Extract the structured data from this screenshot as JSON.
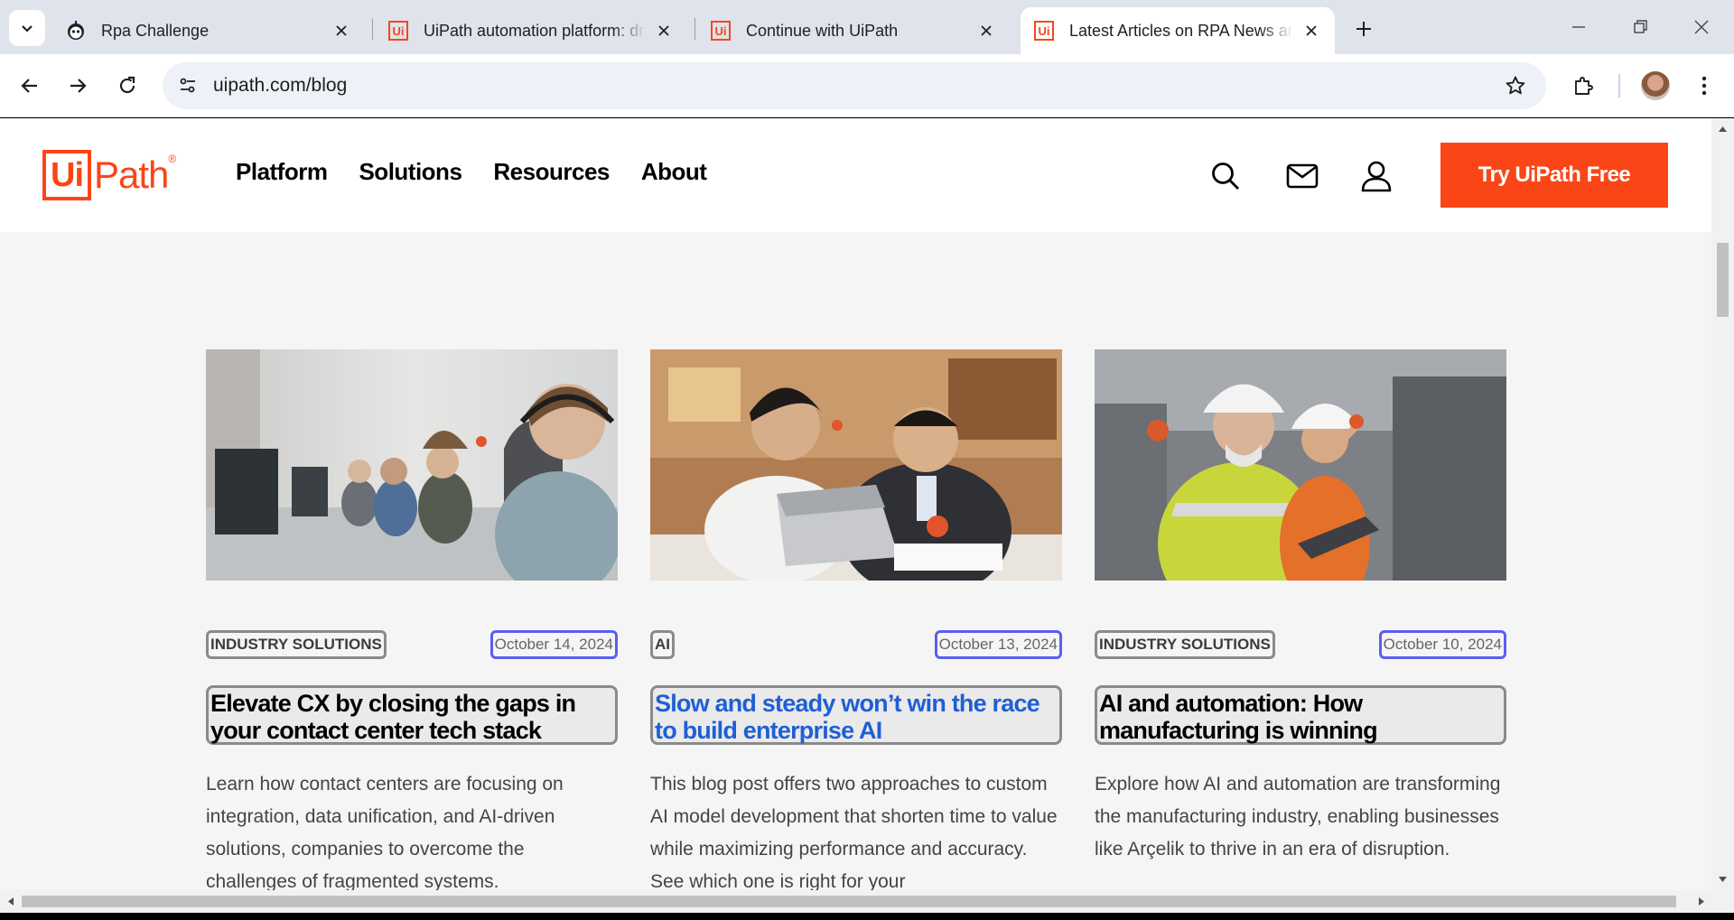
{
  "browser": {
    "tabs": [
      {
        "title": "Rpa Challenge",
        "favicon": "robot-icon",
        "active": false
      },
      {
        "title": "UiPath automation platform: drive",
        "favicon": "uipath-icon",
        "active": false
      },
      {
        "title": "Continue with UiPath",
        "favicon": "uipath-icon",
        "active": false
      },
      {
        "title": "Latest Articles on RPA News and",
        "favicon": "uipath-icon",
        "active": true
      }
    ],
    "favicon_text": "Ui",
    "url": "uipath.com/blog"
  },
  "site": {
    "logo": {
      "ui": "Ui",
      "path": "Path",
      "reg": "®"
    },
    "nav": [
      "Platform",
      "Solutions",
      "Resources",
      "About"
    ],
    "cta": "Try UiPath Free",
    "brand_color": "#fa4616"
  },
  "articles": [
    {
      "tag": "INDUSTRY SOLUTIONS",
      "date": "October 14, 2024",
      "title": "Elevate CX by closing the gaps in your contact center tech stack",
      "excerpt": "Learn how contact centers are focusing on integration, data unification, and AI-driven solutions, companies to overcome the challenges of fragmented systems.",
      "image": "contact-center-agents-photo"
    },
    {
      "tag": "AI",
      "date": "October 13, 2024",
      "title": "Slow and steady won’t win the race to build enterprise AI",
      "excerpt": "This blog post offers two approaches to custom AI model development that shorten time to value while maximizing performance and accuracy. See which one is right for your",
      "image": "two-men-laptop-photo"
    },
    {
      "tag": "INDUSTRY SOLUTIONS",
      "date": "October 10, 2024",
      "title": "AI and automation: How manufacturing is winning",
      "excerpt": "Explore how AI and automation are transforming the manufacturing industry, enabling businesses like Arçelik to thrive in an era of disruption.",
      "image": "factory-workers-tablet-photo"
    }
  ]
}
